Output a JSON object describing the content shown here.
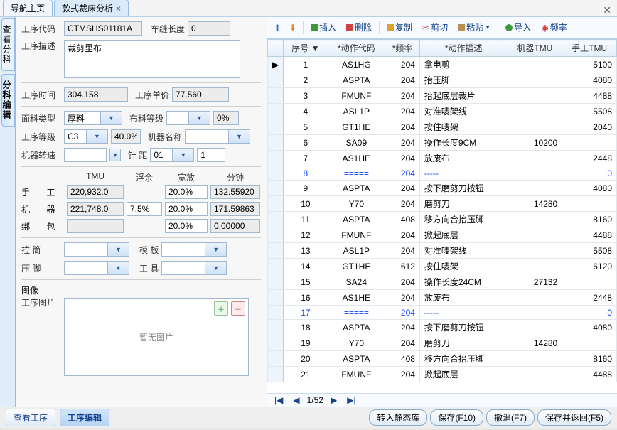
{
  "tabs": {
    "nav": "导航主页",
    "analysis": "款式裁床分析"
  },
  "side": {
    "view": "查看分科",
    "edit": "分科编辑"
  },
  "form": {
    "code_label": "工序代码",
    "code": "CTMSHS01181A",
    "seam_label": "车缝长度",
    "seam": "0",
    "desc_label": "工序描述",
    "desc": "裁剪里布",
    "time_label": "工序时间",
    "time": "304.158",
    "price_label": "工序单价",
    "price": "77.560",
    "fabric_label": "面料类型",
    "fabric": "厚料",
    "fabric_grade_label": "布料等级",
    "fabric_pct": "0%",
    "grade_label": "工序等级",
    "grade": "C3",
    "grade_pct": "40.0%",
    "machine_name_label": "机器名称",
    "rpm_label": "机器转速",
    "pitch_label": "针    距",
    "pitch1": "01",
    "pitch2": "1",
    "head_tmu": "TMU",
    "head_float": "浮余",
    "head_width": "宽放",
    "head_min": "分钟",
    "hand_label": "手    工",
    "hand_tmu": "220,932.0",
    "hand_width": "20.0%",
    "hand_min": "132.55920",
    "mach_label": "机    器",
    "mach_tmu": "221,748.0",
    "mach_float": "7.5%",
    "mach_width": "20.0%",
    "mach_min": "171.59863",
    "bind_label": "绑    包",
    "bind_width": "20.0%",
    "bind_min": "0.00000",
    "pull_label": "拉    筒",
    "tmpl_label": "模    板",
    "foot_label": "压    脚",
    "tool_label": "工    具",
    "img_section": "图像",
    "img_label": "工序图片",
    "img_empty": "暂无图片"
  },
  "toolbar": {
    "insert": "插入",
    "delete": "删除",
    "copy": "复制",
    "cut": "剪切",
    "paste": "粘贴",
    "import": "导入",
    "freq": "频率"
  },
  "grid": {
    "cols": {
      "ind": "",
      "seq": "序号",
      "code": "*动作代码",
      "freq": "*频率",
      "desc": "*动作描述",
      "mtmu": "机器TMU",
      "htmu": "手工TMU"
    },
    "rows": [
      {
        "seq": "1",
        "code": "AS1HG",
        "freq": "204",
        "desc": "拿电剪",
        "mtmu": "",
        "htmu": "5100"
      },
      {
        "seq": "2",
        "code": "ASPTA",
        "freq": "204",
        "desc": "抬压脚",
        "mtmu": "",
        "htmu": "4080"
      },
      {
        "seq": "3",
        "code": "FMUNF",
        "freq": "204",
        "desc": "抬起底层裁片",
        "mtmu": "",
        "htmu": "4488"
      },
      {
        "seq": "4",
        "code": "ASL1P",
        "freq": "204",
        "desc": "对准唛架线",
        "mtmu": "",
        "htmu": "5508"
      },
      {
        "seq": "5",
        "code": "GT1HE",
        "freq": "204",
        "desc": "按住唛架",
        "mtmu": "",
        "htmu": "2040"
      },
      {
        "seq": "6",
        "code": "SA09",
        "freq": "204",
        "desc": "操作长度9CM",
        "mtmu": "10200",
        "htmu": ""
      },
      {
        "seq": "7",
        "code": "AS1HE",
        "freq": "204",
        "desc": "放废布",
        "mtmu": "",
        "htmu": "2448"
      },
      {
        "seq": "8",
        "code": "=====",
        "freq": "204",
        "desc": "-----",
        "mtmu": "",
        "htmu": "0",
        "blue": true
      },
      {
        "seq": "9",
        "code": "ASPTA",
        "freq": "204",
        "desc": "按下磨剪刀按钮",
        "mtmu": "",
        "htmu": "4080"
      },
      {
        "seq": "10",
        "code": "Y70",
        "freq": "204",
        "desc": "磨剪刀",
        "mtmu": "14280",
        "htmu": ""
      },
      {
        "seq": "11",
        "code": "ASPTA",
        "freq": "408",
        "desc": "移方向合抬压脚",
        "mtmu": "",
        "htmu": "8160"
      },
      {
        "seq": "12",
        "code": "FMUNF",
        "freq": "204",
        "desc": "掀起底层",
        "mtmu": "",
        "htmu": "4488"
      },
      {
        "seq": "13",
        "code": "ASL1P",
        "freq": "204",
        "desc": "对准唛架线",
        "mtmu": "",
        "htmu": "5508"
      },
      {
        "seq": "14",
        "code": "GT1HE",
        "freq": "612",
        "desc": "按住唛架",
        "mtmu": "",
        "htmu": "6120"
      },
      {
        "seq": "15",
        "code": "SA24",
        "freq": "204",
        "desc": "操作长度24CM",
        "mtmu": "27132",
        "htmu": ""
      },
      {
        "seq": "16",
        "code": "AS1HE",
        "freq": "204",
        "desc": "放废布",
        "mtmu": "",
        "htmu": "2448"
      },
      {
        "seq": "17",
        "code": "=====",
        "freq": "204",
        "desc": "-----",
        "mtmu": "",
        "htmu": "0",
        "blue": true
      },
      {
        "seq": "18",
        "code": "ASPTA",
        "freq": "204",
        "desc": "按下磨剪刀按钮",
        "mtmu": "",
        "htmu": "4080"
      },
      {
        "seq": "19",
        "code": "Y70",
        "freq": "204",
        "desc": "磨剪刀",
        "mtmu": "14280",
        "htmu": ""
      },
      {
        "seq": "20",
        "code": "ASPTA",
        "freq": "408",
        "desc": "移方向合抬压脚",
        "mtmu": "",
        "htmu": "8160"
      },
      {
        "seq": "21",
        "code": "FMUNF",
        "freq": "204",
        "desc": "掀起底层",
        "mtmu": "",
        "htmu": "4488"
      }
    ],
    "pager": "1/52"
  },
  "bottom": {
    "view": "查看工序",
    "edit": "工序编辑",
    "to_static": "转入静态库",
    "save": "保存(F10)",
    "undo": "撤消(F7)",
    "save_return": "保存并返回(F5)"
  }
}
